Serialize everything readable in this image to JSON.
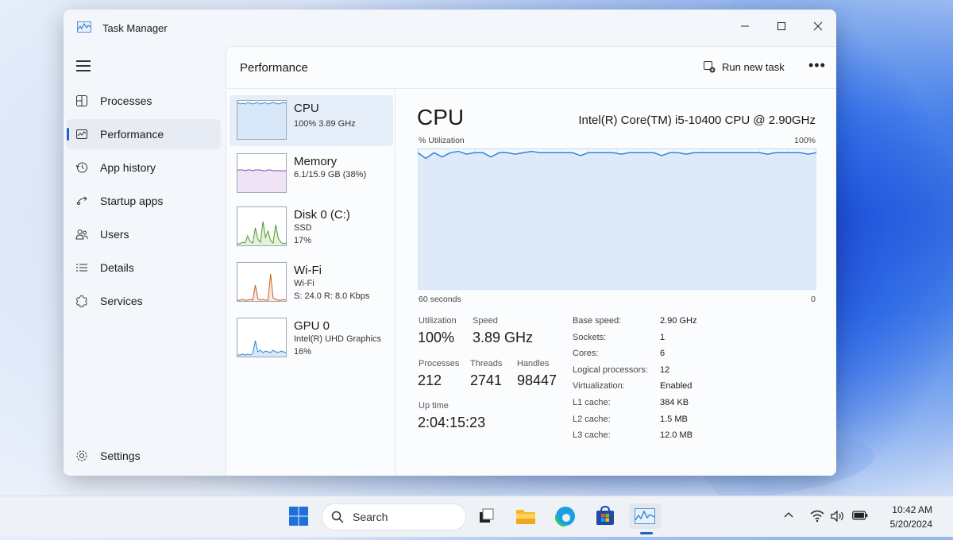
{
  "window": {
    "title": "Task Manager"
  },
  "nav": {
    "items": [
      {
        "label": "Processes",
        "icon": "processes-icon",
        "active": false
      },
      {
        "label": "Performance",
        "icon": "performance-icon",
        "active": true
      },
      {
        "label": "App history",
        "icon": "app-history-icon",
        "active": false
      },
      {
        "label": "Startup apps",
        "icon": "startup-icon",
        "active": false
      },
      {
        "label": "Users",
        "icon": "users-icon",
        "active": false
      },
      {
        "label": "Details",
        "icon": "details-icon",
        "active": false
      },
      {
        "label": "Services",
        "icon": "services-icon",
        "active": false
      }
    ],
    "settings": "Settings"
  },
  "header": {
    "title": "Performance",
    "run_new_task": "Run new task",
    "more": "•••"
  },
  "resources": [
    {
      "name": "CPU",
      "sub1": "100%  3.89 GHz",
      "sub2": "",
      "color": "#2f86d6",
      "fill": "#d8e8f8"
    },
    {
      "name": "Memory",
      "sub1": "6.1/15.9 GB (38%)",
      "sub2": "",
      "color": "#8b4bb5",
      "fill": "#efe4f6"
    },
    {
      "name": "Disk 0 (C:)",
      "sub1": "SSD",
      "sub2": "17%",
      "color": "#4b9a2c",
      "fill": "#e4f2dc"
    },
    {
      "name": "Wi-Fi",
      "sub1": "Wi-Fi",
      "sub2": "S: 24.0  R: 8.0 Kbps",
      "color": "#c2611e",
      "fill": "#fbe9dc"
    },
    {
      "name": "GPU 0",
      "sub1": "Intel(R) UHD Graphics",
      "sub2": "16%",
      "color": "#2f86d6",
      "fill": "#d8e8f8"
    }
  ],
  "cpu": {
    "title": "CPU",
    "model": "Intel(R) Core(TM) i5-10400 CPU @ 2.90GHz",
    "graph_label": "% Utilization",
    "graph_max": "100%",
    "graph_time": "60 seconds",
    "graph_min": "0",
    "utilization_history": [
      97,
      93,
      97,
      94,
      97,
      98,
      96,
      97,
      97,
      94,
      97,
      97,
      96,
      97,
      98,
      97,
      97,
      97,
      97,
      97,
      95,
      97,
      97,
      97,
      97,
      96,
      97,
      97,
      97,
      97,
      95,
      97,
      97,
      96,
      97,
      97,
      97,
      97,
      97,
      97,
      97,
      97,
      97,
      96,
      97,
      97,
      97,
      97,
      96,
      97
    ],
    "stats": {
      "utilization_label": "Utilization",
      "utilization": "100%",
      "speed_label": "Speed",
      "speed": "3.89 GHz",
      "processes_label": "Processes",
      "processes": "212",
      "threads_label": "Threads",
      "threads": "2741",
      "handles_label": "Handles",
      "handles": "98447",
      "uptime_label": "Up time",
      "uptime": "2:04:15:23"
    },
    "specs": [
      {
        "label": "Base speed:",
        "value": "2.90 GHz"
      },
      {
        "label": "Sockets:",
        "value": "1"
      },
      {
        "label": "Cores:",
        "value": "6"
      },
      {
        "label": "Logical processors:",
        "value": "12"
      },
      {
        "label": "Virtualization:",
        "value": "Enabled"
      },
      {
        "label": "L1 cache:",
        "value": "384 KB"
      },
      {
        "label": "L2 cache:",
        "value": "1.5 MB"
      },
      {
        "label": "L3 cache:",
        "value": "12.0 MB"
      }
    ]
  },
  "taskbar": {
    "search": "Search",
    "time": "10:42 AM",
    "date": "5/20/2024"
  }
}
